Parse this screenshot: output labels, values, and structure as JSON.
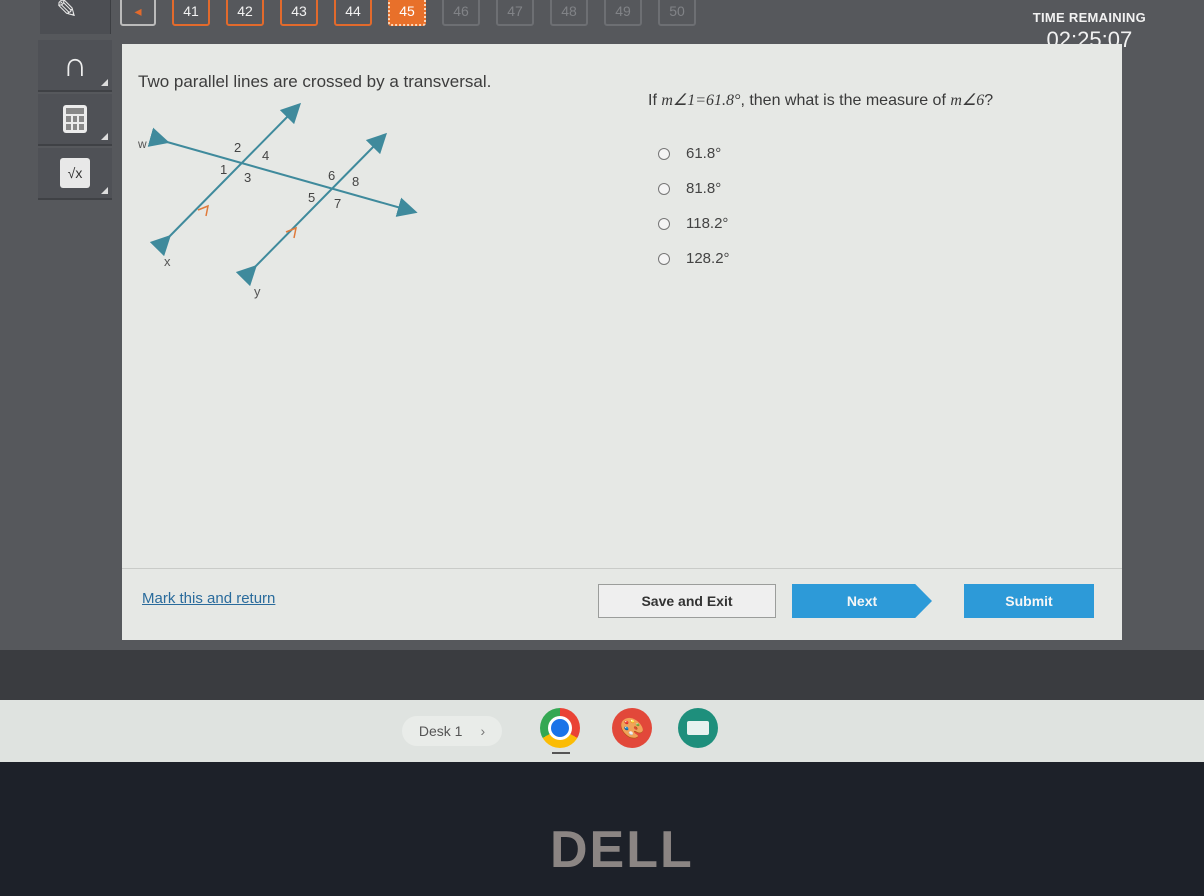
{
  "question_nav": {
    "back_label": "◂",
    "numbers": [
      "41",
      "42",
      "43",
      "44",
      "45",
      "46",
      "47",
      "48",
      "49",
      "50"
    ],
    "current": "45",
    "answered": [
      "41",
      "42",
      "43",
      "44"
    ]
  },
  "timer": {
    "label": "TIME REMAINING",
    "value": "02:25:07"
  },
  "tools": [
    {
      "name": "headphones-icon",
      "glyph": "∩"
    },
    {
      "name": "calculator-icon",
      "glyph": ""
    },
    {
      "name": "formula-sheet-icon",
      "glyph": "√x"
    }
  ],
  "question": {
    "stem": "Two parallel lines are crossed by a transversal.",
    "prompt_pre": "If ",
    "prompt_math1": "m∠1=61.8°",
    "prompt_mid": ", then what is the measure of ",
    "prompt_math2": "m∠6",
    "prompt_post": "?",
    "options": [
      "61.8°",
      "81.8°",
      "118.2°",
      "128.2°"
    ]
  },
  "diagram": {
    "line_labels": {
      "transversal": "w",
      "line1": "x",
      "line2": "y"
    },
    "angle_labels": [
      "1",
      "2",
      "3",
      "4",
      "5",
      "6",
      "7",
      "8"
    ],
    "line_color": "#3f8a9c",
    "parallel_mark_color": "#e07a3a"
  },
  "footer": {
    "mark_label": "Mark this and return",
    "save_label": "Save and Exit",
    "next_label": "Next",
    "submit_label": "Submit"
  },
  "shelf": {
    "desk_label": "Desk 1",
    "chevron": "›",
    "paint_glyph": "🎨"
  },
  "brand": {
    "logo_text": "DELL"
  }
}
